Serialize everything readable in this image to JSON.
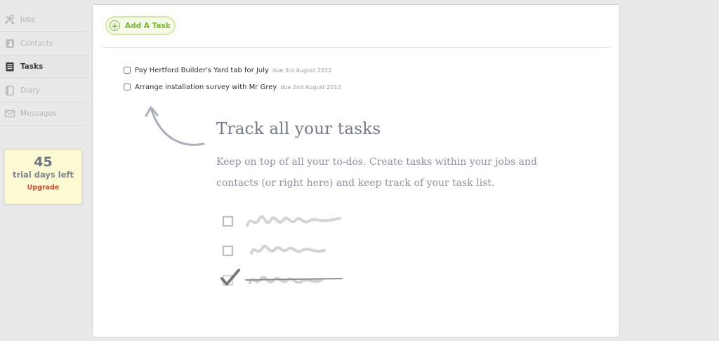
{
  "sidebar": {
    "items": [
      {
        "label": "Jobs",
        "icon": "tools-icon",
        "active": false
      },
      {
        "label": "Contacts",
        "icon": "address-book-icon",
        "active": false
      },
      {
        "label": "Tasks",
        "icon": "tasklist-icon",
        "active": true
      },
      {
        "label": "Diary",
        "icon": "diary-icon",
        "active": false
      },
      {
        "label": "Messages",
        "icon": "envelope-icon",
        "active": false
      }
    ],
    "trial": {
      "days": "45",
      "label": "trial days left",
      "upgrade": "Upgrade"
    }
  },
  "main": {
    "add_task_label": "Add A Task",
    "tasks": [
      {
        "title": "Pay Hertford Builder's Yard tab for July",
        "due": "due 3rd August 2012",
        "done": false
      },
      {
        "title": "Arrange installation survey with Mr Grey",
        "due": "due 2nd August 2012",
        "done": false
      }
    ],
    "empty_state": {
      "title": "Track all your tasks",
      "description": "Keep on top of all your to-dos. Create tasks within your jobs and contacts (or right here) and keep track of your task list."
    }
  },
  "colors": {
    "accent_green": "#76b52f",
    "upgrade_red": "#d9462c",
    "trial_bg": "#fbfad2"
  }
}
